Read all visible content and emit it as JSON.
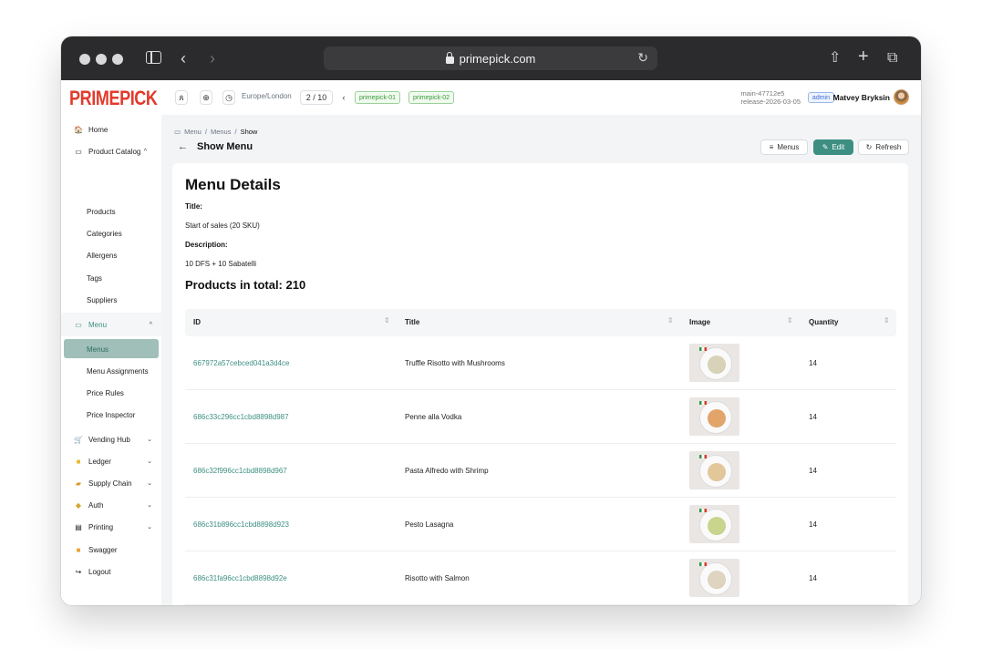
{
  "browser": {
    "url": "primepick.com"
  },
  "header": {
    "logo": "PRIMEPICK",
    "timezone": "Europe/London",
    "page_counter": "2 / 10",
    "tags": [
      "primepick-01",
      "primepick-02"
    ],
    "release_line1": "main-47712e5",
    "release_line2": "release-2026-03-05",
    "role_badge": "admin",
    "user_name": "Matvey Bryksin"
  },
  "sidebar": {
    "home": "Home",
    "product_catalog": "Product Catalog",
    "catalog_items": [
      "Products",
      "Categories",
      "Allergens",
      "Tags",
      "Suppliers"
    ],
    "menu": "Menu",
    "menu_items": [
      "Menus",
      "Menu Assignments",
      "Price Rules",
      "Price Inspector"
    ],
    "groups": [
      "Vending Hub",
      "Ledger",
      "Supply Chain",
      "Auth",
      "Printing"
    ],
    "swagger": "Swagger",
    "logout": "Logout"
  },
  "page": {
    "breadcrumb": [
      "Menu",
      "Menus",
      "Show"
    ],
    "title": "Show Menu",
    "btn_menus": "Menus",
    "btn_edit": "Edit",
    "btn_refresh": "Refresh"
  },
  "details": {
    "heading": "Menu Details",
    "title_label": "Title:",
    "title_value": "Start of sales (20 SKU)",
    "description_label": "Description:",
    "description_value": "10 DFS + 10 Sabatelli",
    "products_total": "Products in total: 210"
  },
  "table": {
    "columns": [
      "ID",
      "Title",
      "Image",
      "Quantity"
    ],
    "rows": [
      {
        "id": "667972a57cebced041a3d4ce",
        "title": "Truffle Risotto with Mushrooms",
        "qty": "14",
        "food_color": "#d8d2b8"
      },
      {
        "id": "686c33c296cc1cbd8898d987",
        "title": "Penne alla Vodka",
        "qty": "14",
        "food_color": "#e2a468"
      },
      {
        "id": "686c32f996cc1cbd8898d967",
        "title": "Pasta Alfredo with Shrimp",
        "qty": "14",
        "food_color": "#e3c79a"
      },
      {
        "id": "686c31b896cc1cbd8898d923",
        "title": "Pesto Lasagna",
        "qty": "14",
        "food_color": "#c9d58d"
      },
      {
        "id": "686c31fa96cc1cbd8898d92e",
        "title": "Risotto with Salmon",
        "qty": "14",
        "food_color": "#ded4bf"
      }
    ]
  }
}
